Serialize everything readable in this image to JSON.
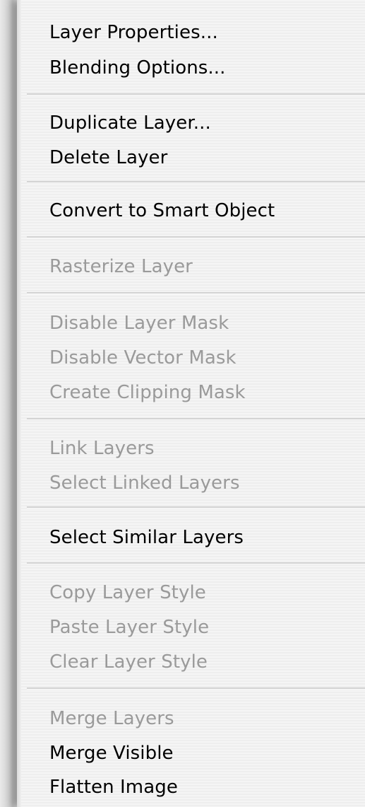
{
  "menu": {
    "groups": [
      {
        "items": [
          {
            "label": "Layer Properties...",
            "enabled": true
          },
          {
            "label": "Blending Options...",
            "enabled": true
          }
        ]
      },
      {
        "items": [
          {
            "label": "Duplicate Layer...",
            "enabled": true
          },
          {
            "label": "Delete Layer",
            "enabled": true
          }
        ]
      },
      {
        "items": [
          {
            "label": "Convert to Smart Object",
            "enabled": true
          }
        ]
      },
      {
        "items": [
          {
            "label": "Rasterize Layer",
            "enabled": false
          }
        ]
      },
      {
        "items": [
          {
            "label": "Disable Layer Mask",
            "enabled": false
          },
          {
            "label": "Disable Vector Mask",
            "enabled": false
          },
          {
            "label": "Create Clipping Mask",
            "enabled": false
          }
        ]
      },
      {
        "items": [
          {
            "label": "Link Layers",
            "enabled": false
          },
          {
            "label": "Select Linked Layers",
            "enabled": false
          }
        ]
      },
      {
        "items": [
          {
            "label": "Select Similar Layers",
            "enabled": true
          }
        ]
      },
      {
        "items": [
          {
            "label": "Copy Layer Style",
            "enabled": false
          },
          {
            "label": "Paste Layer Style",
            "enabled": false
          },
          {
            "label": "Clear Layer Style",
            "enabled": false
          }
        ]
      },
      {
        "items": [
          {
            "label": "Merge Layers",
            "enabled": false
          },
          {
            "label": "Merge Visible",
            "enabled": true
          },
          {
            "label": "Flatten Image",
            "enabled": true
          }
        ]
      }
    ]
  },
  "colors": {
    "enabled_text": "#000000",
    "disabled_text": "#9a9a9a",
    "menu_background": "#f4f4f4",
    "separator": "#d3d3d3"
  }
}
